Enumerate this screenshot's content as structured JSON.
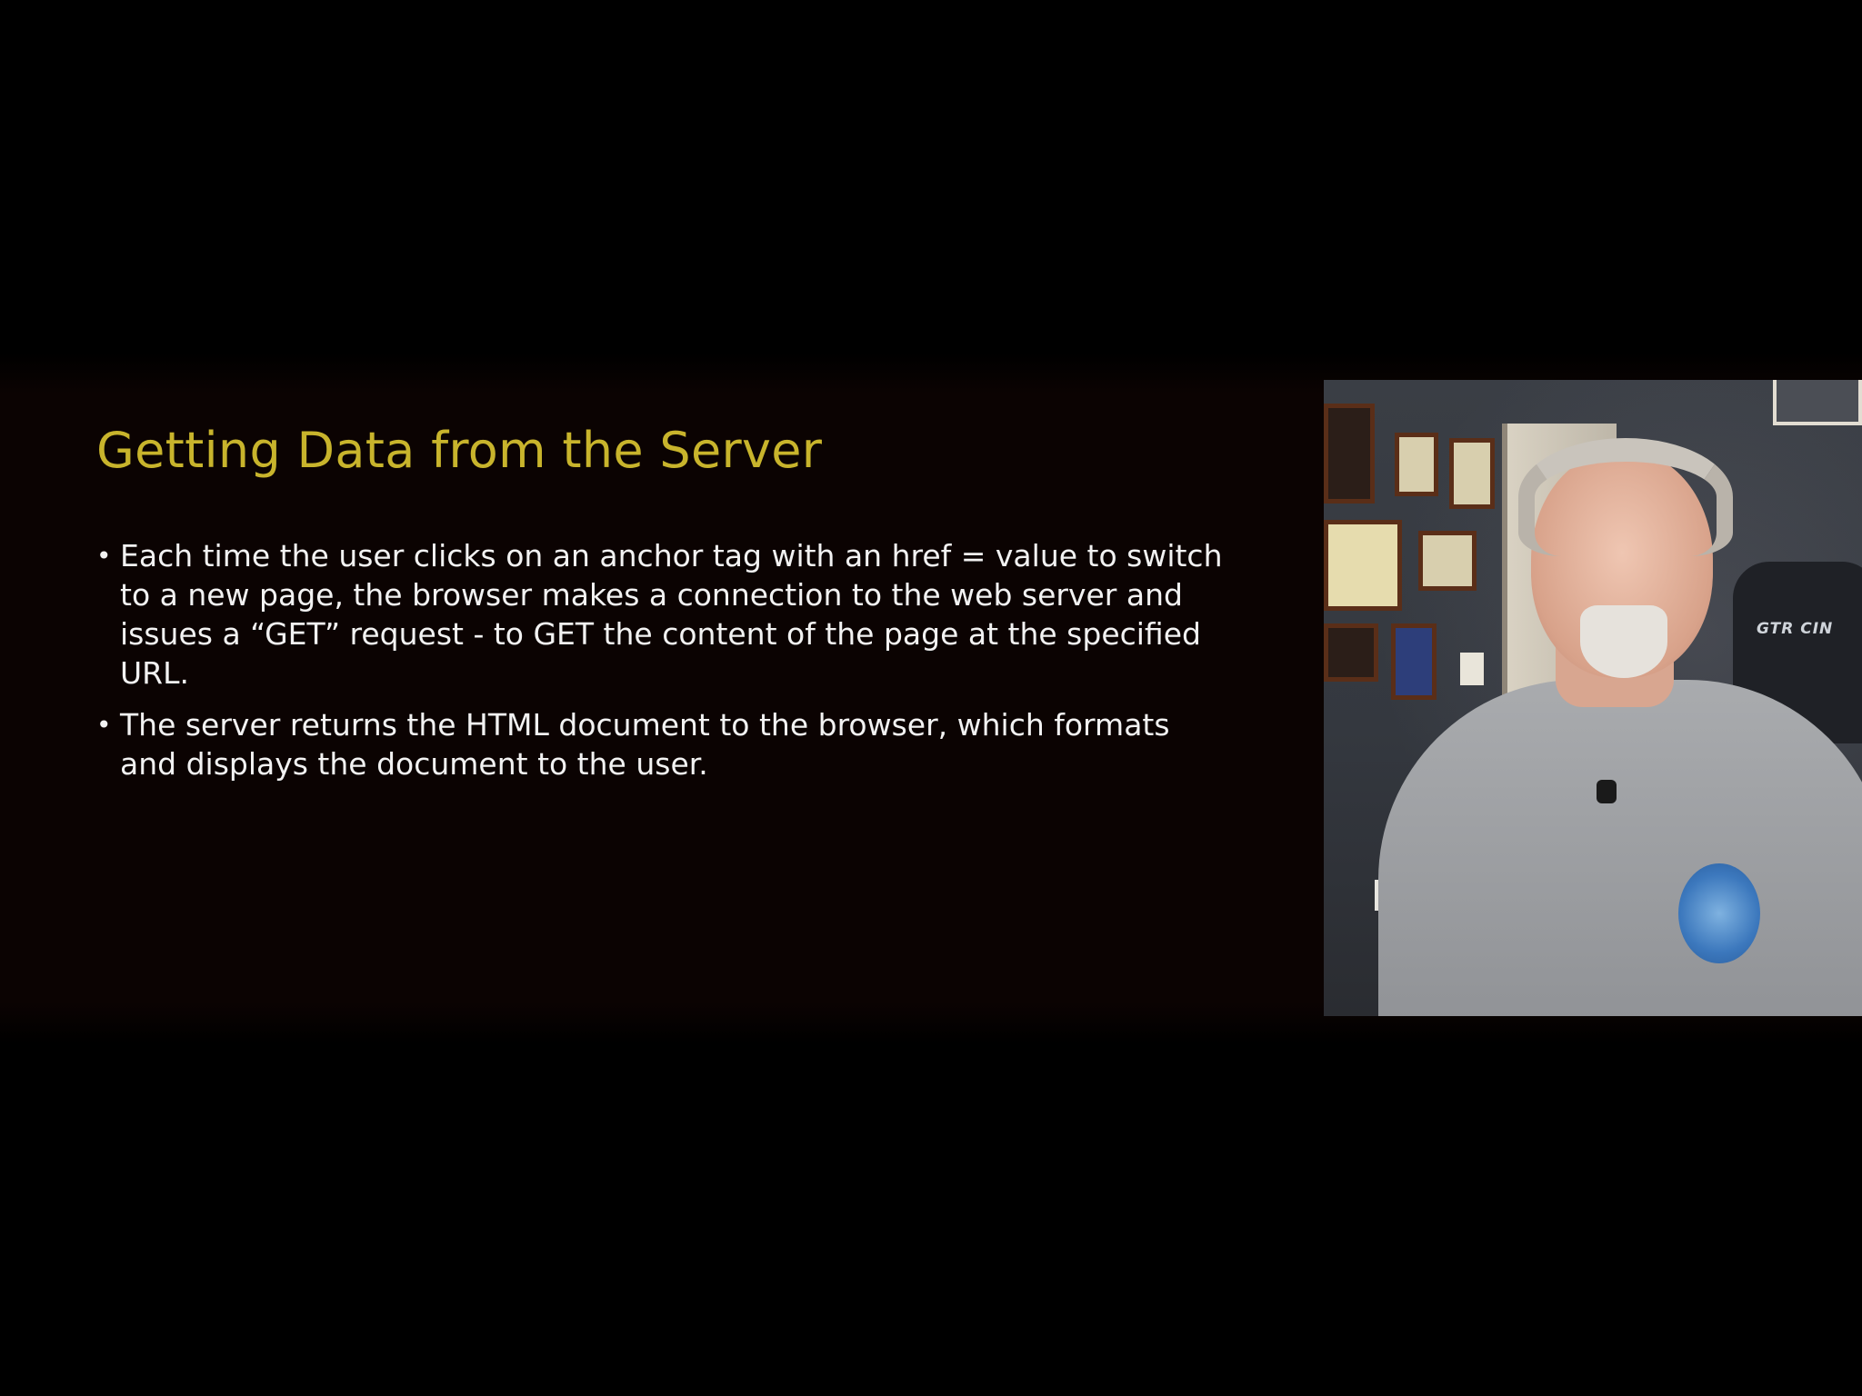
{
  "slide": {
    "title": "Getting Data from the Server",
    "bullets": [
      "Each time the user clicks on an anchor tag with an href =  value to switch to a new page, the browser makes a connection to the web server and issues a “GET” request - to GET the content of the page at the specified URL.",
      "The server returns the HTML document to the browser, which formats and displays the document to the user."
    ],
    "bullet_symbol": "•",
    "title_color": "#c8b42c",
    "text_color": "#f2f2f2",
    "background_color": "#0b0302"
  },
  "webcam": {
    "description_icon": "presenter-webcam",
    "chair_text": "GTR CIN"
  }
}
